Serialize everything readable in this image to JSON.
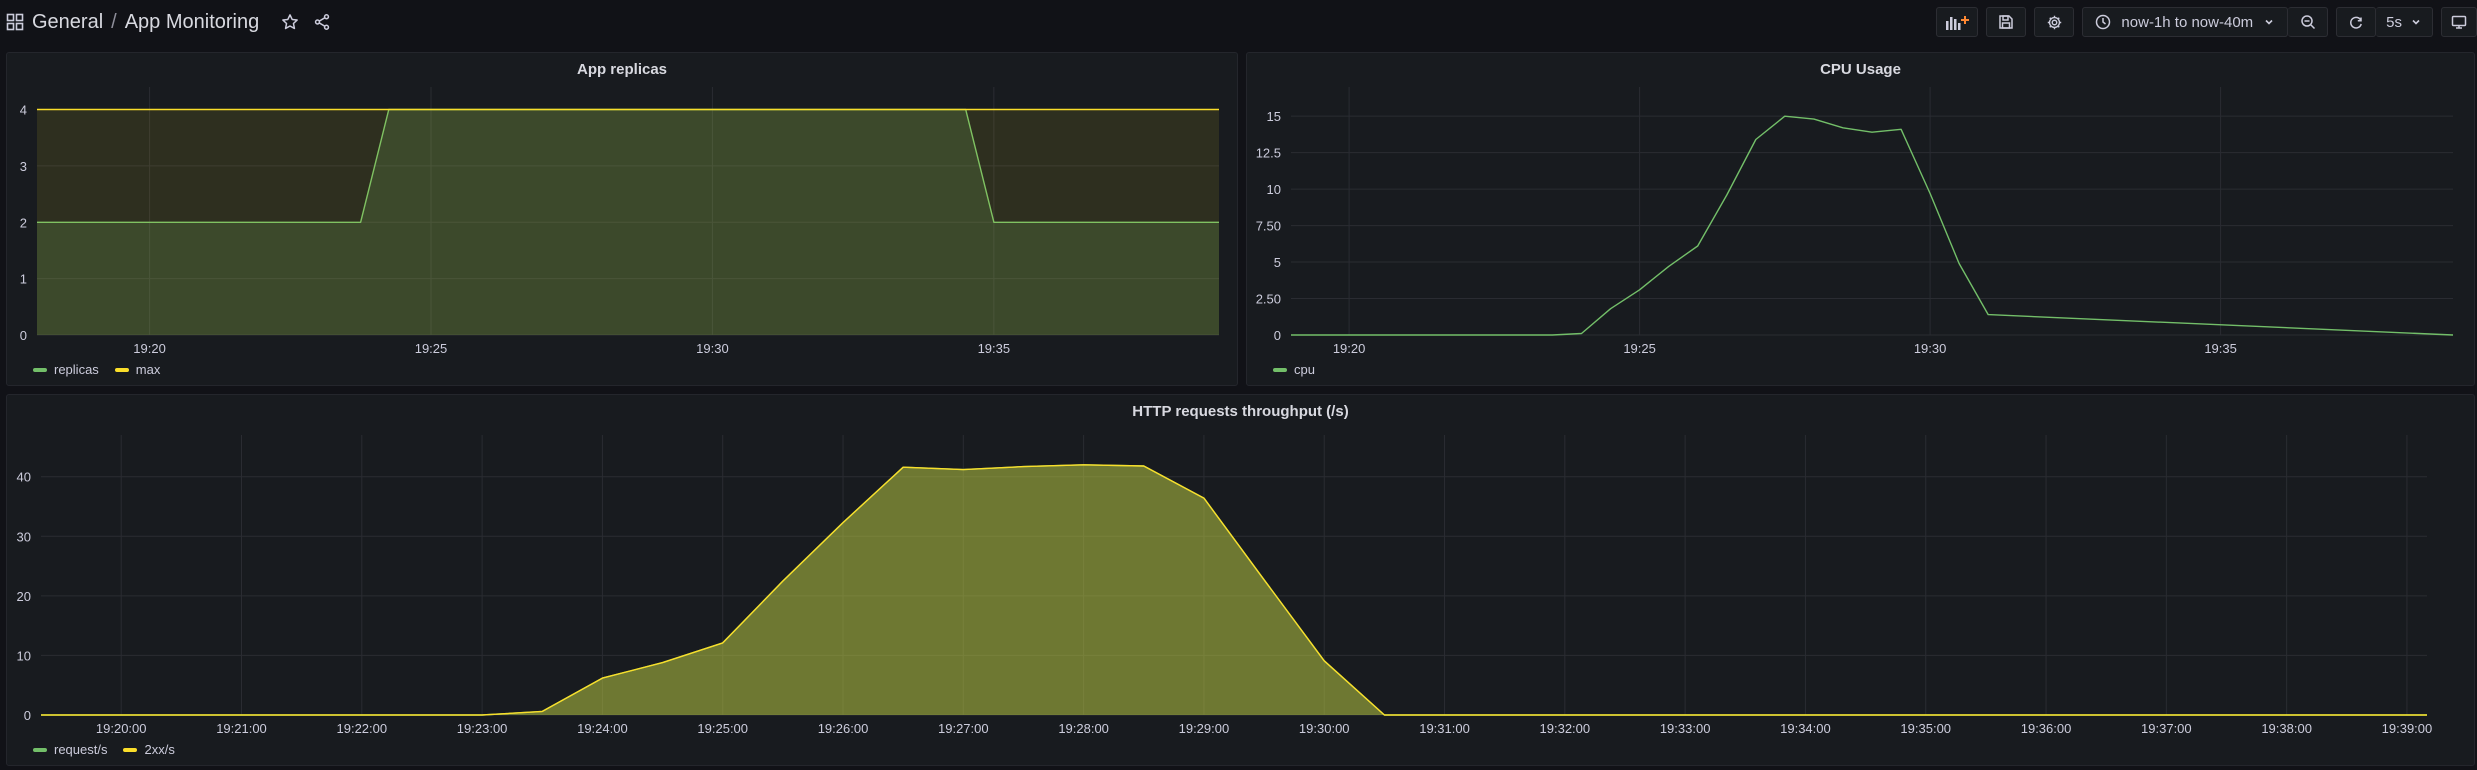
{
  "breadcrumb": {
    "folder": "General",
    "separator": "/",
    "dashboard": "App Monitoring"
  },
  "toolbar": {
    "time_range": "now-1h to now-40m",
    "refresh_interval": "5s"
  },
  "colors": {
    "green": "#73bf69",
    "yellow": "#fade2a",
    "grid": "#2a2c32",
    "text": "#ccccdc"
  },
  "icons": [
    "apps-icon",
    "star-icon",
    "share-icon",
    "add-panel-icon",
    "save-icon",
    "settings-icon",
    "clock-icon",
    "chevron-down-icon",
    "zoom-out-icon",
    "refresh-icon",
    "tv-icon"
  ],
  "panels": {
    "replicas": {
      "title": "App replicas",
      "legend": [
        "replicas",
        "max"
      ]
    },
    "cpu": {
      "title": "CPU Usage",
      "legend": [
        "cpu"
      ]
    },
    "http": {
      "title": "HTTP requests throughput (/s)",
      "legend": [
        "request/s",
        "2xx/s"
      ]
    }
  },
  "chart_data": [
    {
      "type": "area",
      "title": "App replicas",
      "x_unit": "minutes",
      "xlim": [
        "19:18",
        "19:39"
      ],
      "ylim": [
        0,
        4.4
      ],
      "yticks": [
        0,
        1,
        2,
        3,
        4
      ],
      "xticks": [
        "19:20",
        "19:25",
        "19:30",
        "19:35"
      ],
      "series": [
        {
          "name": "replicas",
          "color": "#73bf69",
          "x": [
            "19:18",
            "19:23:45",
            "19:24:15",
            "19:34:30",
            "19:35:00",
            "19:39"
          ],
          "values": [
            2,
            2,
            4,
            4,
            2,
            2
          ]
        },
        {
          "name": "max",
          "color": "#fade2a",
          "x": [
            "19:18",
            "19:39"
          ],
          "values": [
            4,
            4
          ]
        }
      ],
      "grid": true,
      "legend_position": "bottom-left"
    },
    {
      "type": "line",
      "title": "CPU Usage",
      "xlim": [
        "19:19",
        "19:39"
      ],
      "ylim": [
        0,
        17
      ],
      "yticks": [
        0,
        2.5,
        5,
        7.5,
        10,
        12.5,
        15
      ],
      "ytick_labels": [
        "0",
        "2.50",
        "5",
        "7.50",
        "10",
        "12.5",
        "15"
      ],
      "xticks": [
        "19:20",
        "19:25",
        "19:30",
        "19:35"
      ],
      "series": [
        {
          "name": "cpu",
          "color": "#73bf69",
          "x": [
            "19:19",
            "19:23:30",
            "19:24:00",
            "19:24:30",
            "19:25:00",
            "19:25:30",
            "19:26:00",
            "19:26:30",
            "19:27:00",
            "19:27:30",
            "19:28:00",
            "19:28:30",
            "19:29:00",
            "19:29:30",
            "19:30:00",
            "19:30:30",
            "19:31:00",
            "19:39"
          ],
          "values": [
            0,
            0,
            0.1,
            1.8,
            3.1,
            4.7,
            6.1,
            9.6,
            13.4,
            15.0,
            14.8,
            14.2,
            13.9,
            14.1,
            9.7,
            4.9,
            1.4,
            0
          ]
        }
      ],
      "grid": true,
      "legend_position": "bottom-left"
    },
    {
      "type": "area",
      "title": "HTTP requests throughput (/s)",
      "xlim": [
        "19:19:20",
        "19:39:10"
      ],
      "ylim": [
        0,
        47
      ],
      "yticks": [
        0,
        10,
        20,
        30,
        40
      ],
      "xticks": [
        "19:20:00",
        "19:21:00",
        "19:22:00",
        "19:23:00",
        "19:24:00",
        "19:25:00",
        "19:26:00",
        "19:27:00",
        "19:28:00",
        "19:29:00",
        "19:30:00",
        "19:31:00",
        "19:32:00",
        "19:33:00",
        "19:34:00",
        "19:35:00",
        "19:36:00",
        "19:37:00",
        "19:38:00",
        "19:39:00"
      ],
      "series": [
        {
          "name": "request/s",
          "color": "#73bf69",
          "x": [
            "19:19:20",
            "19:23:00",
            "19:23:30",
            "19:24:00",
            "19:24:30",
            "19:25:00",
            "19:25:30",
            "19:26:00",
            "19:26:30",
            "19:27:00",
            "19:27:30",
            "19:28:00",
            "19:28:30",
            "19:29:00",
            "19:29:30",
            "19:30:00",
            "19:30:30",
            "19:39:10"
          ],
          "values": [
            0,
            0,
            0.6,
            6.2,
            8.8,
            12.1,
            22.5,
            32.3,
            41.6,
            41.2,
            41.7,
            42.0,
            41.8,
            36.4,
            22.7,
            9.1,
            0,
            0
          ]
        },
        {
          "name": "2xx/s",
          "color": "#fade2a",
          "x": [
            "19:19:20",
            "19:23:00",
            "19:23:30",
            "19:24:00",
            "19:24:30",
            "19:25:00",
            "19:25:30",
            "19:26:00",
            "19:26:30",
            "19:27:00",
            "19:27:30",
            "19:28:00",
            "19:28:30",
            "19:29:00",
            "19:29:30",
            "19:30:00",
            "19:30:30",
            "19:39:10"
          ],
          "values": [
            0,
            0,
            0.6,
            6.2,
            8.8,
            12.1,
            22.5,
            32.3,
            41.6,
            41.2,
            41.7,
            42.0,
            41.8,
            36.4,
            22.7,
            9.1,
            0,
            0
          ]
        }
      ],
      "grid": true,
      "legend_position": "bottom-left"
    }
  ]
}
